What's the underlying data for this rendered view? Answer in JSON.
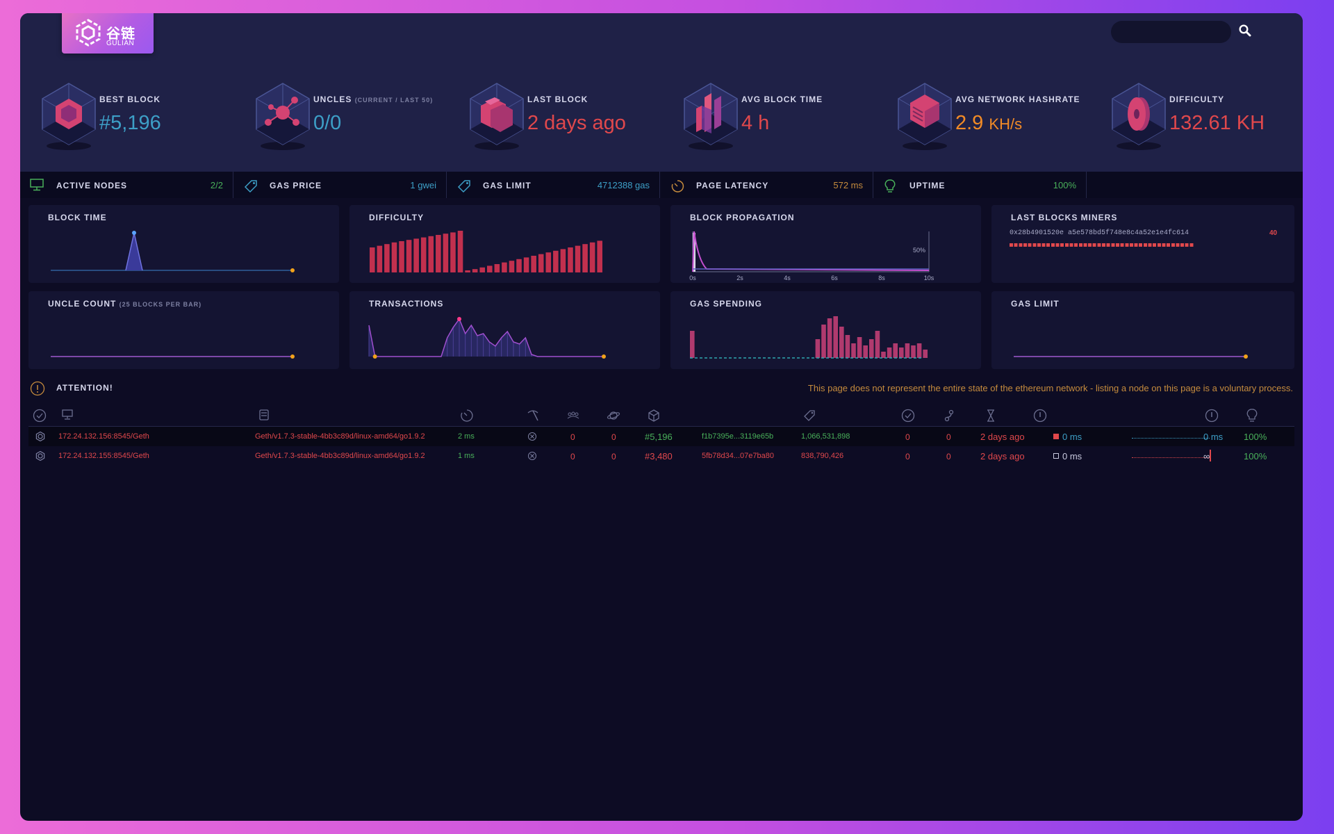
{
  "logo": {
    "text_cn": "谷链",
    "text_en": "GULIAN"
  },
  "search": {
    "placeholder": ""
  },
  "stats": {
    "best_block": {
      "label": "BEST BLOCK",
      "value": "#5,196"
    },
    "uncles": {
      "label": "UNCLES",
      "sub": "(CURRENT / LAST 50)",
      "value": "0/0"
    },
    "last_block": {
      "label": "LAST BLOCK",
      "value": "2 days ago"
    },
    "avg_block_time": {
      "label": "AVG BLOCK TIME",
      "value": "4 h"
    },
    "avg_hashrate": {
      "label": "AVG NETWORK HASHRATE",
      "value": "2.9",
      "unit": "KH/s"
    },
    "difficulty": {
      "label": "DIFFICULTY",
      "value": "132.61 KH"
    }
  },
  "infobar": {
    "active_nodes": {
      "label": "ACTIVE NODES",
      "value": "2/2"
    },
    "gas_price": {
      "label": "GAS PRICE",
      "value": "1 gwei"
    },
    "gas_limit": {
      "label": "GAS LIMIT",
      "value": "4712388 gas"
    },
    "page_latency": {
      "label": "PAGE LATENCY",
      "value": "572 ms"
    },
    "uptime": {
      "label": "UPTIME",
      "value": "100%"
    }
  },
  "charts": {
    "block_time": {
      "title": "BLOCK TIME"
    },
    "difficulty": {
      "title": "DIFFICULTY"
    },
    "block_propagation": {
      "title": "BLOCK PROPAGATION",
      "label_50": "50%",
      "ticks": [
        "0s",
        "2s",
        "4s",
        "6s",
        "8s",
        "10s"
      ]
    },
    "last_blocks_miners": {
      "title": "LAST BLOCKS MINERS",
      "miner": "0x28b4901520e a5e578bd5f748e8c4a52e1e4fc614",
      "count": "40"
    },
    "uncle_count": {
      "title": "UNCLE COUNT",
      "sub": "(25 BLOCKS PER BAR)"
    },
    "transactions": {
      "title": "TRANSACTIONS"
    },
    "gas_spending": {
      "title": "GAS SPENDING"
    },
    "gas_limit": {
      "title": "GAS LIMIT"
    }
  },
  "attention": {
    "label": "ATTENTION!",
    "message": "This page does not represent the entire state of the ethereum network - listing a node on this page is a voluntary process."
  },
  "nodes": [
    {
      "name": "172.24.132.156:8545/Geth",
      "client": "Geth/v1.7.3-stable-4bb3c89d/linux-amd64/go1.9.2",
      "latency": "2 ms",
      "peers": "0",
      "pending": "0",
      "block": "#5,196",
      "hash": "f1b7395e...3119e65b",
      "diff": "1,066,531,898",
      "txs": "0",
      "uncles": "0",
      "last": "2 days ago",
      "prop": "0 ms",
      "avg_prop": "0 ms",
      "uptime": "100%"
    },
    {
      "name": "172.24.132.155:8545/Geth",
      "client": "Geth/v1.7.3-stable-4bb3c89d/linux-amd64/go1.9.2",
      "latency": "1 ms",
      "peers": "0",
      "pending": "0",
      "block": "#3,480",
      "hash": "5fb78d34...07e7ba80",
      "diff": "838,790,426",
      "txs": "0",
      "uncles": "0",
      "last": "2 days ago",
      "prop": "0 ms",
      "avg_prop": "∞",
      "uptime": "100%"
    }
  ],
  "colors": {
    "accent_red": "#e0484c",
    "accent_blue": "#3d9fc7",
    "accent_orange": "#f28b26",
    "accent_green": "#49b05a"
  },
  "chart_data": [
    {
      "type": "line",
      "title": "BLOCK TIME",
      "x": [
        0,
        1,
        2,
        3,
        4,
        5,
        6,
        7,
        8,
        9,
        10,
        11,
        12,
        13,
        14,
        15,
        16,
        17,
        18,
        19,
        20,
        21,
        22,
        23,
        24,
        25,
        26,
        27,
        28,
        29,
        30
      ],
      "values": [
        0,
        0,
        0,
        0,
        0,
        0,
        0,
        0,
        0,
        1,
        0,
        0,
        0,
        0,
        0,
        0,
        0,
        0,
        0,
        0,
        0,
        0,
        0,
        0,
        0,
        0,
        0,
        0,
        0,
        0,
        0
      ]
    },
    {
      "type": "bar",
      "title": "DIFFICULTY",
      "values": [
        0.6,
        0.64,
        0.68,
        0.72,
        0.75,
        0.78,
        0.81,
        0.84,
        0.87,
        0.9,
        0.93,
        0.96,
        1.0,
        0.05,
        0.08,
        0.12,
        0.16,
        0.2,
        0.24,
        0.28,
        0.32,
        0.36,
        0.4,
        0.44,
        0.48,
        0.52,
        0.56,
        0.6,
        0.64,
        0.68,
        0.72,
        0.76
      ]
    },
    {
      "type": "line",
      "title": "BLOCK PROPAGATION",
      "x": [
        0,
        2,
        4,
        6,
        8,
        10
      ],
      "ylabel": "50%"
    },
    {
      "type": "bar",
      "title": "LAST BLOCKS MINERS",
      "categories": [
        "0x28b4901520e a5e578bd5f748e8c4a52e1e4fc614"
      ],
      "values": [
        40
      ]
    },
    {
      "type": "line",
      "title": "UNCLE COUNT",
      "values": [
        0,
        0,
        0,
        0,
        0,
        0,
        0,
        0,
        0,
        0,
        0,
        0,
        0,
        0,
        0,
        0,
        0,
        0,
        0,
        0
      ]
    },
    {
      "type": "area",
      "title": "TRANSACTIONS",
      "values": [
        0.75,
        0,
        0,
        0,
        0,
        0,
        0,
        0,
        0,
        0,
        0,
        0,
        0,
        0.45,
        0.7,
        0.9,
        0.55,
        0.75,
        0.5,
        0.55,
        0.35,
        0.25,
        0.45,
        0.6,
        0.35,
        0.3,
        0.45,
        0.05,
        0,
        0,
        0,
        0,
        0,
        0,
        0,
        0,
        0,
        0,
        0,
        0
      ]
    },
    {
      "type": "bar",
      "title": "GAS SPENDING",
      "values": [
        0.65,
        0,
        0,
        0,
        0,
        0,
        0,
        0,
        0,
        0,
        0,
        0,
        0,
        0,
        0,
        0,
        0,
        0,
        0,
        0,
        0,
        0.45,
        0.8,
        0.95,
        1.0,
        0.75,
        0.55,
        0.35,
        0.5,
        0.3,
        0.45,
        0.65,
        0.15,
        0.25,
        0.35,
        0.25,
        0.35,
        0.3,
        0.35,
        0.2
      ]
    },
    {
      "type": "line",
      "title": "GAS LIMIT",
      "values": [
        0,
        0,
        0,
        0,
        0,
        0,
        0,
        0,
        0,
        0,
        0,
        0,
        0,
        0,
        0,
        0,
        0,
        0,
        0,
        0
      ]
    }
  ]
}
